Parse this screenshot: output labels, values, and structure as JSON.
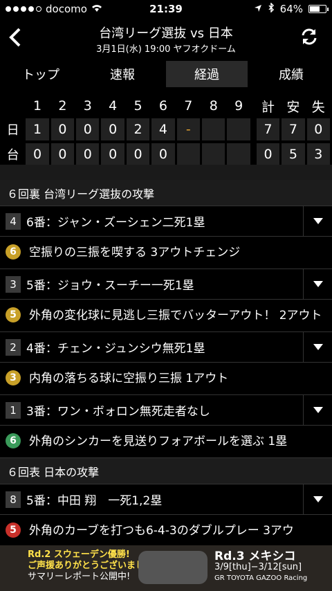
{
  "status": {
    "carrier": "docomo",
    "time": "21:39",
    "battery": "64%"
  },
  "header": {
    "title": "台湾リーグ選抜 vs 日本",
    "subtitle": "3月1日(水) 19:00 ヤフオクドーム"
  },
  "tabs": [
    "トップ",
    "速報",
    "経過",
    "成績"
  ],
  "active_tab": "経過",
  "scoreboard": {
    "innings": [
      "1",
      "2",
      "3",
      "4",
      "5",
      "6",
      "7",
      "8",
      "9"
    ],
    "totals_headers": [
      "計",
      "安",
      "失"
    ],
    "rows": [
      {
        "team": "日",
        "scores": [
          "1",
          "0",
          "0",
          "0",
          "2",
          "4",
          "-",
          "",
          ""
        ],
        "totals": [
          "7",
          "7",
          "0"
        ]
      },
      {
        "team": "台",
        "scores": [
          "0",
          "0",
          "0",
          "0",
          "0",
          "0",
          "",
          "",
          ""
        ],
        "totals": [
          "0",
          "5",
          "3"
        ]
      }
    ]
  },
  "feed": [
    {
      "type": "section",
      "text": "６回裏 台湾リーグ選抜の攻撃"
    },
    {
      "type": "batter",
      "num": "4",
      "text": "6番：ジャン・ズーシェン二死1塁"
    },
    {
      "type": "play",
      "badge": "6",
      "color": "#c8a028",
      "text": "空振りの三振を喫する 3アウトチェンジ"
    },
    {
      "type": "batter",
      "num": "3",
      "text": "5番：ジョウ・スーチー一死1塁"
    },
    {
      "type": "play",
      "badge": "5",
      "color": "#c8a028",
      "text": "外角の変化球に見逃し三振でバッターアウト！ 2アウト"
    },
    {
      "type": "batter",
      "num": "2",
      "text": "4番：チェン・ジュンシウ無死1塁"
    },
    {
      "type": "play",
      "badge": "3",
      "color": "#c8a028",
      "text": "内角の落ちる球に空振り三振 1アウト"
    },
    {
      "type": "batter",
      "num": "1",
      "text": "3番：ワン・ボォロン無死走者なし"
    },
    {
      "type": "play",
      "badge": "6",
      "color": "#3a9a5a",
      "text": "外角のシンカーを見送りフォアボールを選ぶ 1塁"
    },
    {
      "type": "section",
      "text": "６回表 日本の攻撃"
    },
    {
      "type": "batter",
      "num": "8",
      "text": "5番：中田 翔　一死1,2塁"
    },
    {
      "type": "play",
      "badge": "5",
      "color": "#c8302a",
      "text": "外角のカーブを打つも6-4-3のダブルプレー 3アウ"
    }
  ],
  "ad": {
    "line1": "Rd.2 スウェーデン優勝!",
    "line2": "ご声援ありがとうございました!",
    "line3": "サマリーレポート公開中!",
    "right1": "Rd.3 メキシコ",
    "right2": "3/9[thu]−3/12[sun]",
    "right3": "GR TOYOTA GAZOO Racing"
  }
}
